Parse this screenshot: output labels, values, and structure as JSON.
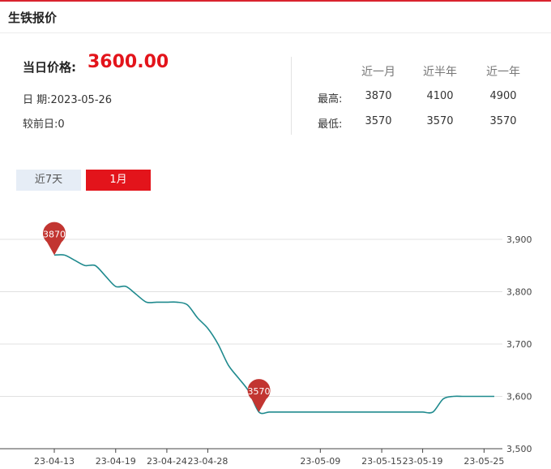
{
  "header": {
    "title": "生铁报价"
  },
  "summary": {
    "price_label": "当日价格:",
    "price_value": "3600.00",
    "date_label": "日 期:",
    "date_value": "2023-05-26",
    "prev_label": "较前日:",
    "prev_value": "0"
  },
  "stats": {
    "headers": [
      "近一月",
      "近半年",
      "近一年"
    ],
    "rows": [
      {
        "label": "最高:",
        "values": [
          "3870",
          "4100",
          "4900"
        ]
      },
      {
        "label": "最低:",
        "values": [
          "3570",
          "3570",
          "3570"
        ]
      }
    ]
  },
  "tabs": [
    {
      "label": "近7天",
      "active": false
    },
    {
      "label": "1月",
      "active": true
    }
  ],
  "colors": {
    "accent": "#e3141b",
    "line": "#1f8a8e",
    "marker": "#c23531"
  },
  "chart_data": {
    "type": "line",
    "x": [
      "23-04-13",
      "23-04-14",
      "23-04-15",
      "23-04-16",
      "23-04-17",
      "23-04-18",
      "23-04-19",
      "23-04-20",
      "23-04-21",
      "23-04-22",
      "23-04-23",
      "23-04-24",
      "23-04-25",
      "23-04-26",
      "23-04-27",
      "23-04-28",
      "23-04-29",
      "23-04-30",
      "23-05-01",
      "23-05-02",
      "23-05-03",
      "23-05-04",
      "23-05-05",
      "23-05-06",
      "23-05-07",
      "23-05-08",
      "23-05-09",
      "23-05-10",
      "23-05-11",
      "23-05-12",
      "23-05-13",
      "23-05-14",
      "23-05-15",
      "23-05-16",
      "23-05-17",
      "23-05-18",
      "23-05-19",
      "23-05-20",
      "23-05-21",
      "23-05-22",
      "23-05-23",
      "23-05-24",
      "23-05-25",
      "23-05-26"
    ],
    "values": [
      3870,
      3870,
      3860,
      3850,
      3850,
      3830,
      3810,
      3810,
      3795,
      3780,
      3780,
      3780,
      3780,
      3775,
      3750,
      3730,
      3700,
      3660,
      3635,
      3610,
      3570,
      3570,
      3570,
      3570,
      3570,
      3570,
      3570,
      3570,
      3570,
      3570,
      3570,
      3570,
      3570,
      3570,
      3570,
      3570,
      3570,
      3570,
      3595,
      3600,
      3600,
      3600,
      3600,
      3600
    ],
    "x_ticks": [
      "23-04-13",
      "23-04-19",
      "23-04-24",
      "23-04-28",
      "23-05-09",
      "23-05-15",
      "23-05-19",
      "23-05-25"
    ],
    "y_ticks": [
      "3,500",
      "3,600",
      "3,700",
      "3,800",
      "3,900"
    ],
    "ylim": [
      3500,
      3900
    ],
    "markers": [
      {
        "label": "3870",
        "index": 0,
        "value": 3870
      },
      {
        "label": "3570",
        "index": 20,
        "value": 3570
      }
    ],
    "grid": true,
    "y_axis_side": "right"
  }
}
